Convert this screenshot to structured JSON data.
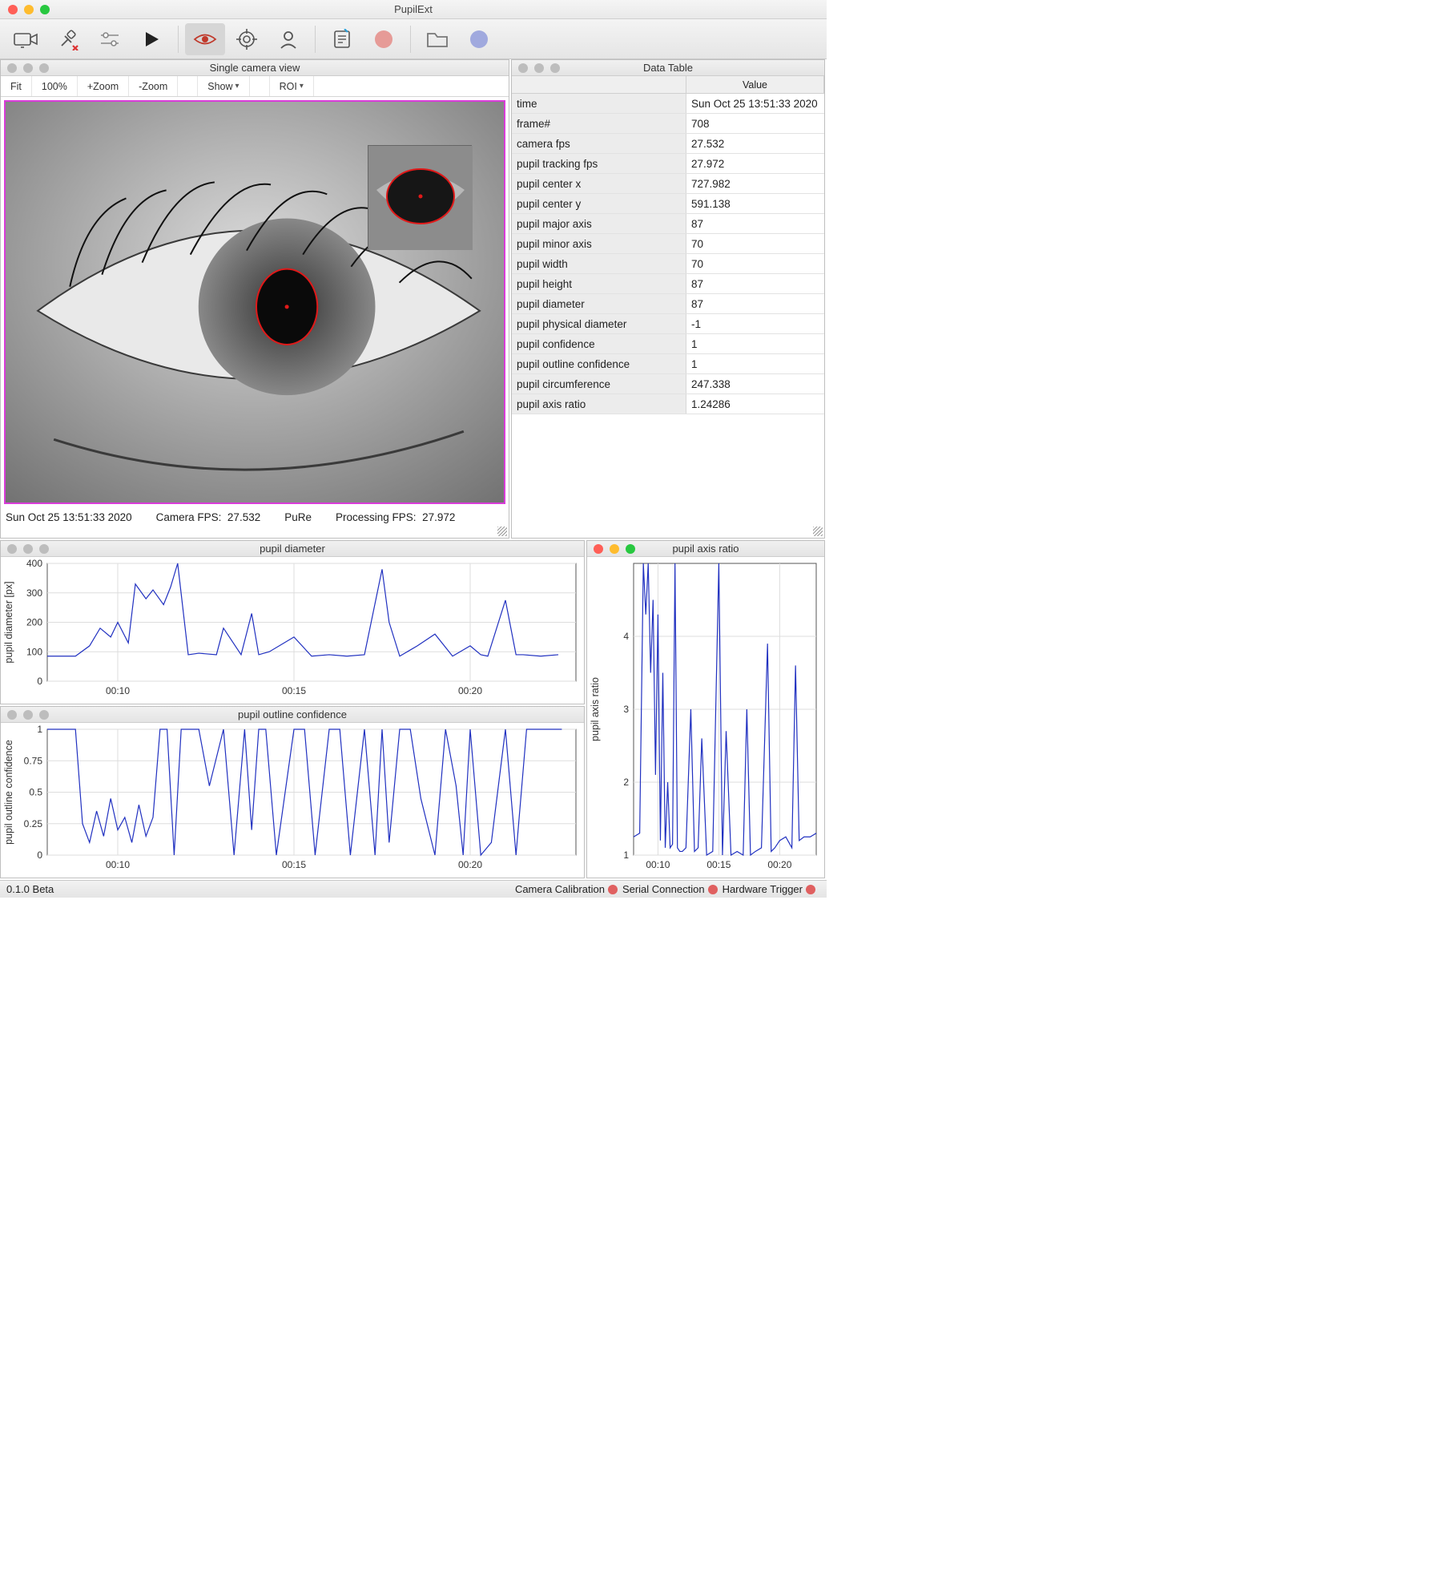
{
  "app": {
    "title": "PupilExt"
  },
  "toolbar": {
    "camera": "camera",
    "connect": "connect",
    "settings": "settings-slider",
    "play": "play",
    "eye": "pupil-detect",
    "target": "calibrate",
    "subject": "subject",
    "log": "log",
    "record_dot": "record",
    "folder": "open-folder",
    "blue_dot": "marker"
  },
  "camview": {
    "title": "Single camera view",
    "btns": {
      "fit": "Fit",
      "hundred": "100%",
      "zoomin": "+Zoom",
      "zoomout": "-Zoom",
      "show": "Show",
      "roi": "ROI"
    },
    "status": {
      "timestamp": "Sun Oct 25 13:51:33 2020",
      "camfps_label": "Camera FPS:",
      "camfps": "27.532",
      "algo": "PuRe",
      "procfps_label": "Processing FPS:",
      "procfps": "27.972"
    }
  },
  "datatable": {
    "title": "Data Table",
    "valueHeader": "Value",
    "rows": [
      {
        "k": "time",
        "v": "Sun Oct 25 13:51:33 2020"
      },
      {
        "k": "frame#",
        "v": "708"
      },
      {
        "k": "camera fps",
        "v": "27.532"
      },
      {
        "k": "pupil tracking fps",
        "v": "27.972"
      },
      {
        "k": "pupil center x",
        "v": "727.982"
      },
      {
        "k": "pupil center y",
        "v": "591.138"
      },
      {
        "k": "pupil major axis",
        "v": "87"
      },
      {
        "k": "pupil minor axis",
        "v": "70"
      },
      {
        "k": "pupil width",
        "v": "70"
      },
      {
        "k": "pupil height",
        "v": "87"
      },
      {
        "k": "pupil diameter",
        "v": "87"
      },
      {
        "k": "pupil physical diameter",
        "v": "-1"
      },
      {
        "k": "pupil confidence",
        "v": "1"
      },
      {
        "k": "pupil outline confidence",
        "v": "1"
      },
      {
        "k": "pupil circumference",
        "v": "247.338"
      },
      {
        "k": "pupil axis ratio",
        "v": "1.24286"
      }
    ]
  },
  "footer": {
    "version": "0.1.0 Beta",
    "camcal": "Camera Calibration",
    "serial": "Serial Connection",
    "hwtrig": "Hardware Trigger"
  },
  "charts": {
    "diameter": {
      "title": "pupil diameter",
      "ylabel": "pupil diameter [px]"
    },
    "outline": {
      "title": "pupil outline confidence",
      "ylabel": "pupil outline confidence"
    },
    "ratio": {
      "title": "pupil axis ratio",
      "ylabel": "pupil axis ratio"
    }
  },
  "chart_data": [
    {
      "type": "line",
      "title": "pupil diameter",
      "ylabel": "pupil diameter [px]",
      "ylim": [
        0,
        400
      ],
      "yticks": [
        0,
        100,
        200,
        300,
        400
      ],
      "xticks": [
        "00:10",
        "00:15",
        "00:20"
      ],
      "series": [
        {
          "name": "diameter",
          "x": [
            8.0,
            8.8,
            9.2,
            9.5,
            9.8,
            10.0,
            10.3,
            10.5,
            10.8,
            11.0,
            11.3,
            11.5,
            11.7,
            12.0,
            12.3,
            12.8,
            13.0,
            13.5,
            13.8,
            14.0,
            14.3,
            15.0,
            15.5,
            16.0,
            16.5,
            17.0,
            17.5,
            17.7,
            18.0,
            18.5,
            19.0,
            19.5,
            20.0,
            20.3,
            20.5,
            21.0,
            21.3,
            21.5,
            22.0,
            22.5
          ],
          "y": [
            85,
            85,
            120,
            180,
            150,
            200,
            130,
            330,
            280,
            310,
            260,
            320,
            400,
            90,
            95,
            90,
            180,
            90,
            230,
            90,
            100,
            150,
            85,
            90,
            85,
            90,
            380,
            200,
            85,
            120,
            160,
            85,
            120,
            90,
            85,
            275,
            90,
            90,
            85,
            90
          ]
        }
      ]
    },
    {
      "type": "line",
      "title": "pupil outline confidence",
      "ylabel": "pupil outline confidence",
      "ylim": [
        0,
        1
      ],
      "yticks": [
        0,
        0.25,
        0.5,
        0.75,
        1
      ],
      "xticks": [
        "00:10",
        "00:15",
        "00:20"
      ],
      "series": [
        {
          "name": "confidence",
          "x": [
            8.0,
            8.8,
            9.0,
            9.2,
            9.4,
            9.6,
            9.8,
            10.0,
            10.2,
            10.4,
            10.6,
            10.8,
            11.0,
            11.2,
            11.4,
            11.6,
            11.8,
            12.0,
            12.3,
            12.6,
            13.0,
            13.3,
            13.6,
            13.8,
            14.0,
            14.2,
            14.5,
            15.0,
            15.3,
            15.6,
            16.0,
            16.3,
            16.6,
            17.0,
            17.3,
            17.5,
            17.7,
            18.0,
            18.3,
            18.6,
            19.0,
            19.3,
            19.6,
            19.8,
            20.0,
            20.3,
            20.6,
            21.0,
            21.3,
            21.6,
            22.0,
            22.3,
            22.6
          ],
          "y": [
            1,
            1,
            0.25,
            0.1,
            0.35,
            0.15,
            0.45,
            0.2,
            0.3,
            0.1,
            0.4,
            0.15,
            0.3,
            1,
            1,
            0.0,
            1,
            1,
            1,
            0.55,
            1,
            0.0,
            1,
            0.2,
            1,
            1,
            0.0,
            1,
            1,
            0.0,
            1,
            1,
            0.0,
            1,
            0.0,
            1,
            0.1,
            1,
            1,
            0.45,
            0.0,
            1,
            0.55,
            0.0,
            1,
            0.0,
            0.1,
            1,
            0.0,
            1,
            1,
            1,
            1
          ]
        }
      ]
    },
    {
      "type": "line",
      "title": "pupil axis ratio",
      "ylabel": "pupil axis ratio",
      "ylim": [
        1,
        5
      ],
      "yticks": [
        1,
        2,
        3,
        4
      ],
      "xticks": [
        "00:10",
        "00:15",
        "00:20"
      ],
      "series": [
        {
          "name": "ratio",
          "x": [
            8.0,
            8.5,
            8.8,
            9.0,
            9.2,
            9.4,
            9.6,
            9.8,
            10.0,
            10.2,
            10.4,
            10.6,
            10.8,
            11.0,
            11.2,
            11.4,
            11.6,
            11.8,
            12.0,
            12.3,
            12.7,
            13.0,
            13.3,
            13.6,
            14.0,
            14.5,
            15.0,
            15.3,
            15.6,
            16.0,
            16.5,
            17.0,
            17.3,
            17.6,
            18.0,
            18.5,
            19.0,
            19.3,
            19.6,
            20.0,
            20.5,
            21.0,
            21.3,
            21.6,
            22.0,
            22.5,
            23.0
          ],
          "y": [
            1.25,
            1.3,
            5.0,
            4.3,
            5.0,
            3.5,
            4.5,
            2.1,
            4.3,
            1.2,
            3.5,
            1.1,
            2.0,
            1.1,
            1.15,
            5.0,
            1.1,
            1.05,
            1.05,
            1.1,
            3.0,
            1.05,
            1.1,
            2.6,
            1.0,
            1.05,
            5.0,
            1.0,
            2.7,
            1.0,
            1.05,
            1.0,
            3.0,
            1.0,
            1.05,
            1.1,
            3.9,
            1.05,
            1.1,
            1.2,
            1.25,
            1.1,
            3.6,
            1.2,
            1.25,
            1.25,
            1.3
          ]
        }
      ]
    }
  ]
}
